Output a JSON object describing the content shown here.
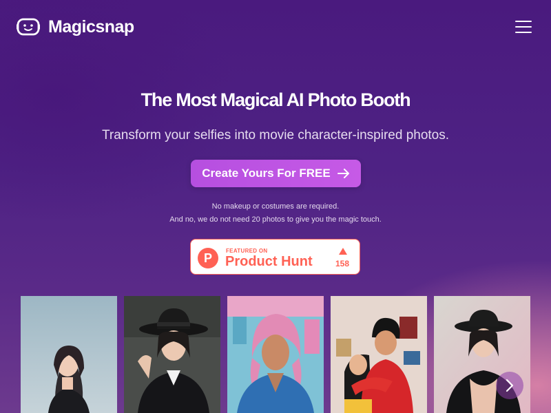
{
  "brand": {
    "name": "Magicsnap"
  },
  "nav": {
    "menu_icon": "hamburger-menu-icon"
  },
  "hero": {
    "title": "The Most Magical AI Photo Booth",
    "subtitle": "Transform your selfies into movie character-inspired photos.",
    "cta_label": "Create Yours For FREE",
    "note_line1": "No makeup or costumes are required.",
    "note_line2": "And no, we do not need 20 photos to give you the magic touch."
  },
  "product_hunt": {
    "featured_label": "FEATURED ON",
    "name": "Product Hunt",
    "logo_letter": "P",
    "upvotes": "158",
    "color": "#ff6154"
  },
  "gallery": {
    "items": [
      {
        "name": "anime-portrait-woman"
      },
      {
        "name": "portrait-woman-black-hat"
      },
      {
        "name": "portrait-man-pink-hair"
      },
      {
        "name": "cartoon-couple-hug"
      },
      {
        "name": "portrait-woman-black-hat-2"
      }
    ],
    "next_icon": "chevron-right-icon"
  },
  "colors": {
    "accent": "#c65ae6",
    "background": "#4e2284"
  }
}
